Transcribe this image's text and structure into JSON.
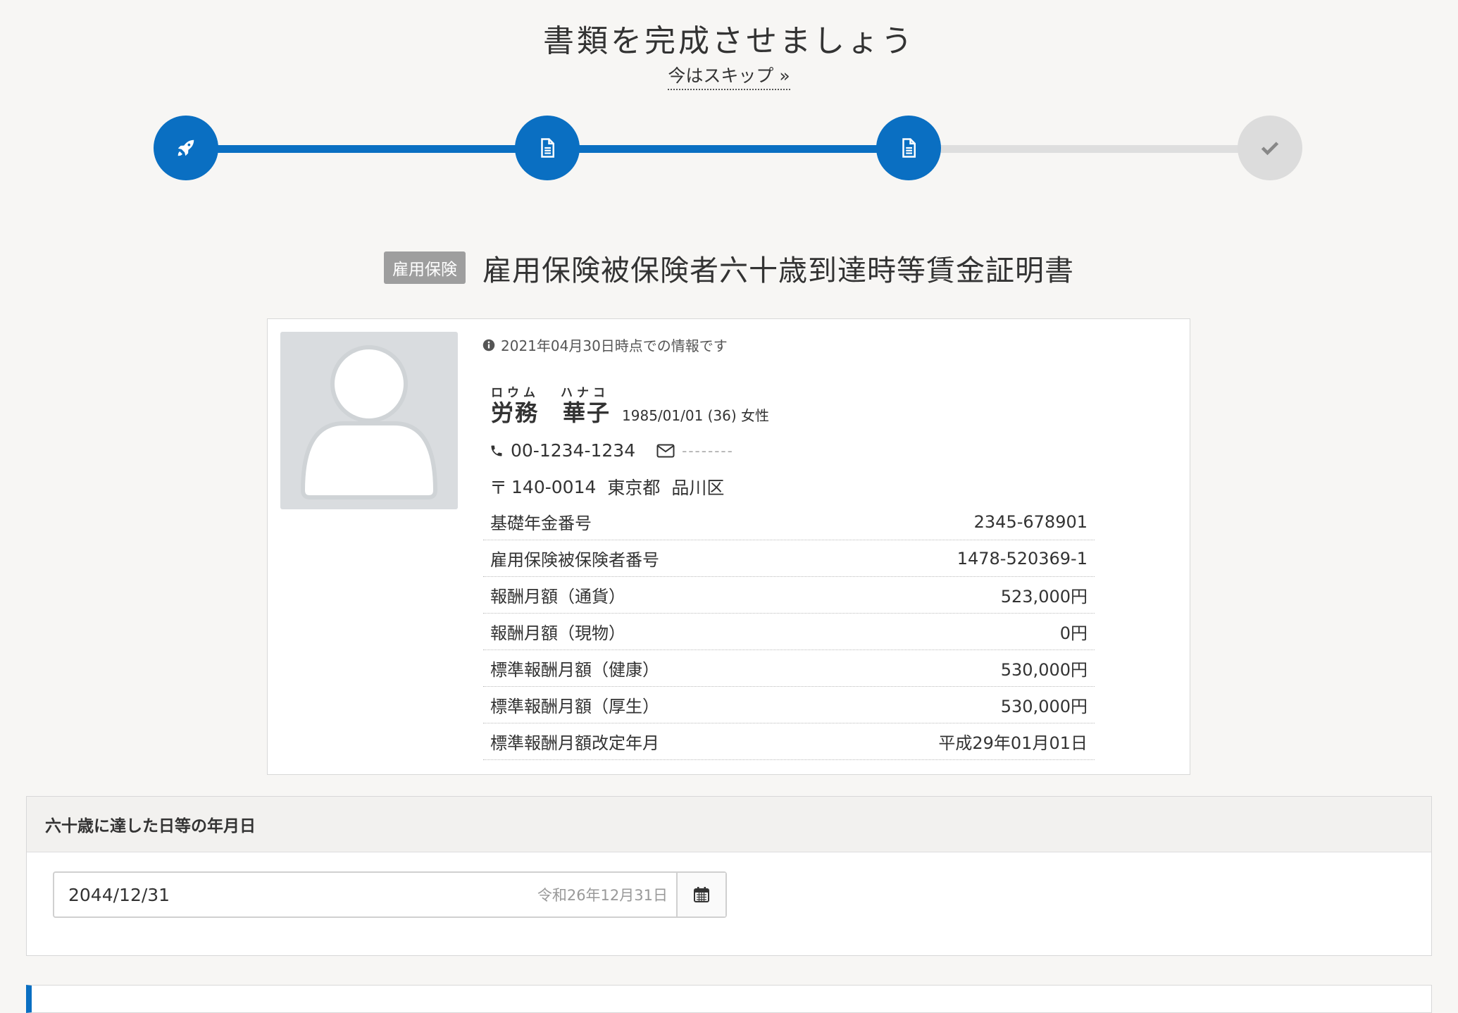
{
  "header": {
    "title": "書類を完成させましょう",
    "skip_label": "今はスキップ »"
  },
  "stepper": {
    "steps": [
      {
        "icon": "rocket-icon",
        "state": "done"
      },
      {
        "icon": "document-icon",
        "state": "done"
      },
      {
        "icon": "document-icon",
        "state": "done"
      },
      {
        "icon": "check-icon",
        "state": "todo"
      }
    ],
    "colors": {
      "done": "#0a6fc2",
      "todo": "#dcdcdc"
    }
  },
  "document": {
    "badge": "雇用保険",
    "title": "雇用保険被保険者六十歳到達時等賃金証明書"
  },
  "profile": {
    "note": "2021年04月30日時点での情報です",
    "kana_family": "ロウム",
    "kana_given": "ハナコ",
    "name": "労務　華子",
    "meta": "1985/01/01 (36) 女性",
    "phone": "00-1234-1234",
    "email": "--------",
    "postal_mark": "〒",
    "postal_code": "140-0014",
    "prefecture": "東京都",
    "city": "品川区",
    "rows": [
      {
        "label": "基礎年金番号",
        "value": "2345-678901"
      },
      {
        "label": "雇用保険被保険者番号",
        "value": "1478-520369-1"
      },
      {
        "label": "報酬月額（通貨）",
        "value": "523,000円"
      },
      {
        "label": "報酬月額（現物）",
        "value": "0円"
      },
      {
        "label": "標準報酬月額（健康）",
        "value": "530,000円"
      },
      {
        "label": "標準報酬月額（厚生）",
        "value": "530,000円"
      },
      {
        "label": "標準報酬月額改定年月",
        "value": "平成29年01月01日"
      }
    ]
  },
  "section": {
    "title": "六十歳に達した日等の年月日",
    "date_value": "2044/12/31",
    "date_era": "令和26年12月31日"
  }
}
